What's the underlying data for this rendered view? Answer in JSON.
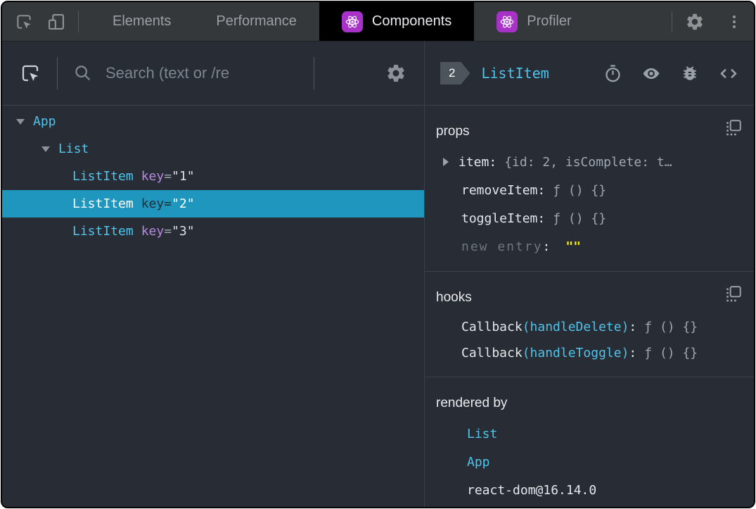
{
  "colors": {
    "accent_cyan": "#4fc3ea",
    "selection_blue": "#1f96bd",
    "key_purple": "#b48ae0",
    "editable_yellow": "#f5ed00",
    "react_icon_purple": "#a832c8",
    "panel_bg": "#282c34"
  },
  "chrome_bar": {
    "tabs": [
      {
        "label": "Elements"
      },
      {
        "label": "Performance"
      },
      {
        "label": "Components"
      },
      {
        "label": "Profiler"
      }
    ]
  },
  "left_panel": {
    "search_placeholder": "Search (text or /re",
    "tree": {
      "rows": [
        {
          "name": "App"
        },
        {
          "name": "List"
        },
        {
          "name": "ListItem",
          "key_name": "key",
          "eq": "=",
          "key_value": "\"1\""
        },
        {
          "name": "ListItem",
          "key_name": "key",
          "eq": "=",
          "key_value": "\"2\""
        },
        {
          "name": "ListItem",
          "key_name": "key",
          "eq": "=",
          "key_value": "\"3\""
        }
      ]
    }
  },
  "right_panel": {
    "header": {
      "badge": "2",
      "title": "ListItem"
    },
    "props": {
      "title": "props",
      "rows": [
        {
          "name": "item:",
          "value": "{id: 2, isComplete: t…"
        },
        {
          "name": "removeItem:",
          "value": "ƒ () {}"
        },
        {
          "name": "toggleItem:",
          "value": "ƒ () {}"
        }
      ],
      "new_entry": {
        "label": "new entry",
        "colon": ":",
        "value": "\"\""
      }
    },
    "hooks": {
      "title": "hooks",
      "rows": [
        {
          "fn": "Callback",
          "arg": "(handleDelete)",
          "colon": ":",
          "value": "ƒ () {}"
        },
        {
          "fn": "Callback",
          "arg": "(handleToggle)",
          "colon": ":",
          "value": "ƒ () {}"
        }
      ]
    },
    "rendered_by": {
      "title": "rendered by",
      "owners": [
        {
          "label": "List"
        },
        {
          "label": "App"
        }
      ],
      "root": "react-dom@16.14.0"
    }
  }
}
